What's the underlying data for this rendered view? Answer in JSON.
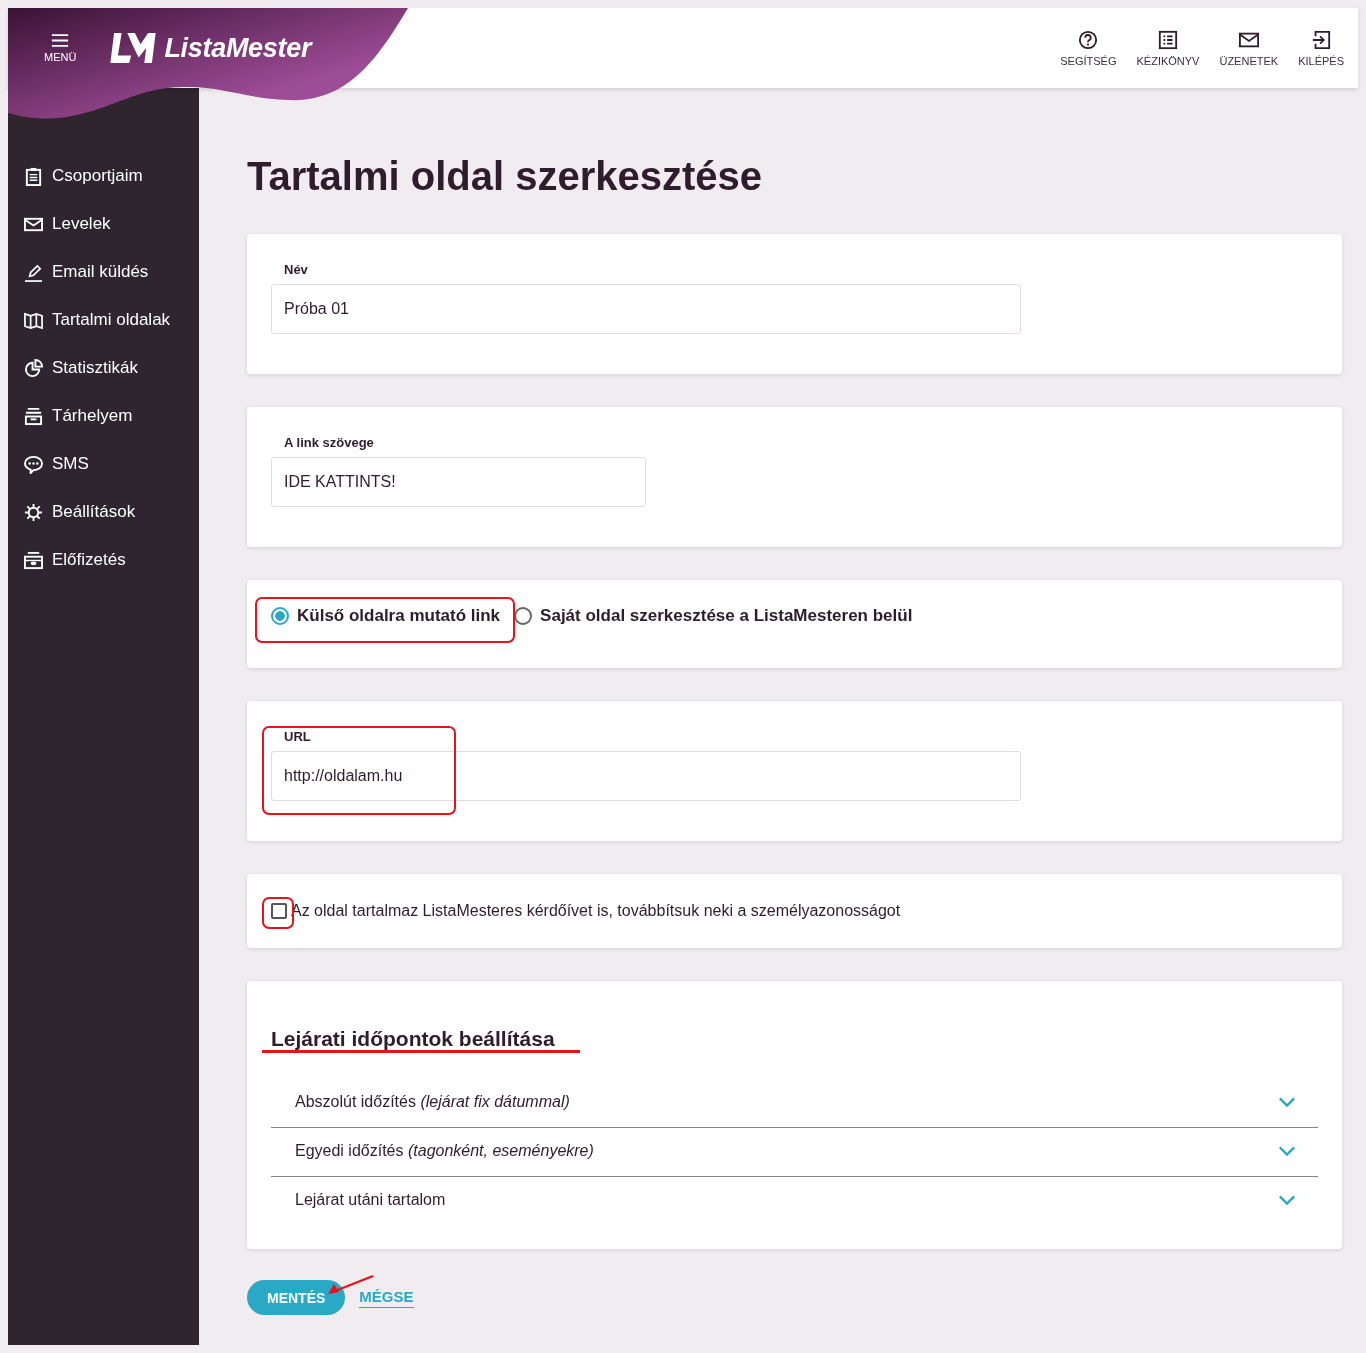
{
  "header": {
    "menu_label": "MENÜ",
    "logo_text": "ListaMester",
    "actions": [
      {
        "kind": "help",
        "label": "SEGÍTSÉG"
      },
      {
        "kind": "manual",
        "label": "KÉZIKÖNYV"
      },
      {
        "kind": "messages",
        "label": "ÜZENETEK"
      },
      {
        "kind": "logout",
        "label": "KILÉPÉS"
      }
    ]
  },
  "sidebar": {
    "items": [
      {
        "kind": "groups",
        "label": "Csoportjaim"
      },
      {
        "kind": "letters",
        "label": "Levelek"
      },
      {
        "kind": "send",
        "label": "Email küldés"
      },
      {
        "kind": "pages",
        "label": "Tartalmi oldalak"
      },
      {
        "kind": "stats",
        "label": "Statisztikák"
      },
      {
        "kind": "storage",
        "label": "Tárhelyem"
      },
      {
        "kind": "sms",
        "label": "SMS"
      },
      {
        "kind": "settings",
        "label": "Beállítások"
      },
      {
        "kind": "subscription",
        "label": "Előfizetés"
      }
    ]
  },
  "page_title": "Tartalmi oldal szerkesztése",
  "name_field": {
    "label": "Név",
    "value": "Próba 01"
  },
  "link_text_field": {
    "label": "A link szövege",
    "value": "IDE KATTINTS!"
  },
  "link_type": [
    {
      "label": "Külső oldalra mutató link",
      "selected": true
    },
    {
      "label": "Saját oldal szerkesztése a ListaMesteren belül",
      "selected": false
    }
  ],
  "url_field": {
    "label": "URL",
    "value": "http://oldalam.hu"
  },
  "identity_checkbox": {
    "label": "Az oldal tartalmaz ListaMesteres kérdőívet is, továbbítsuk neki a személyazonosságot",
    "checked": false
  },
  "expiry": {
    "title": "Lejárati időpontok beállítása",
    "sections": [
      {
        "title": "Abszolút időzítés *(lejárat fix dátummal)*",
        "expanded": false
      },
      {
        "title": "Egyedi időzítés *(tagonként, eseményekre)*",
        "expanded": false
      },
      {
        "title": "Lejárat utáni tartalom",
        "expanded": false
      }
    ]
  },
  "buttons": {
    "save": "MENTÉS",
    "cancel": "MÉGSE"
  }
}
